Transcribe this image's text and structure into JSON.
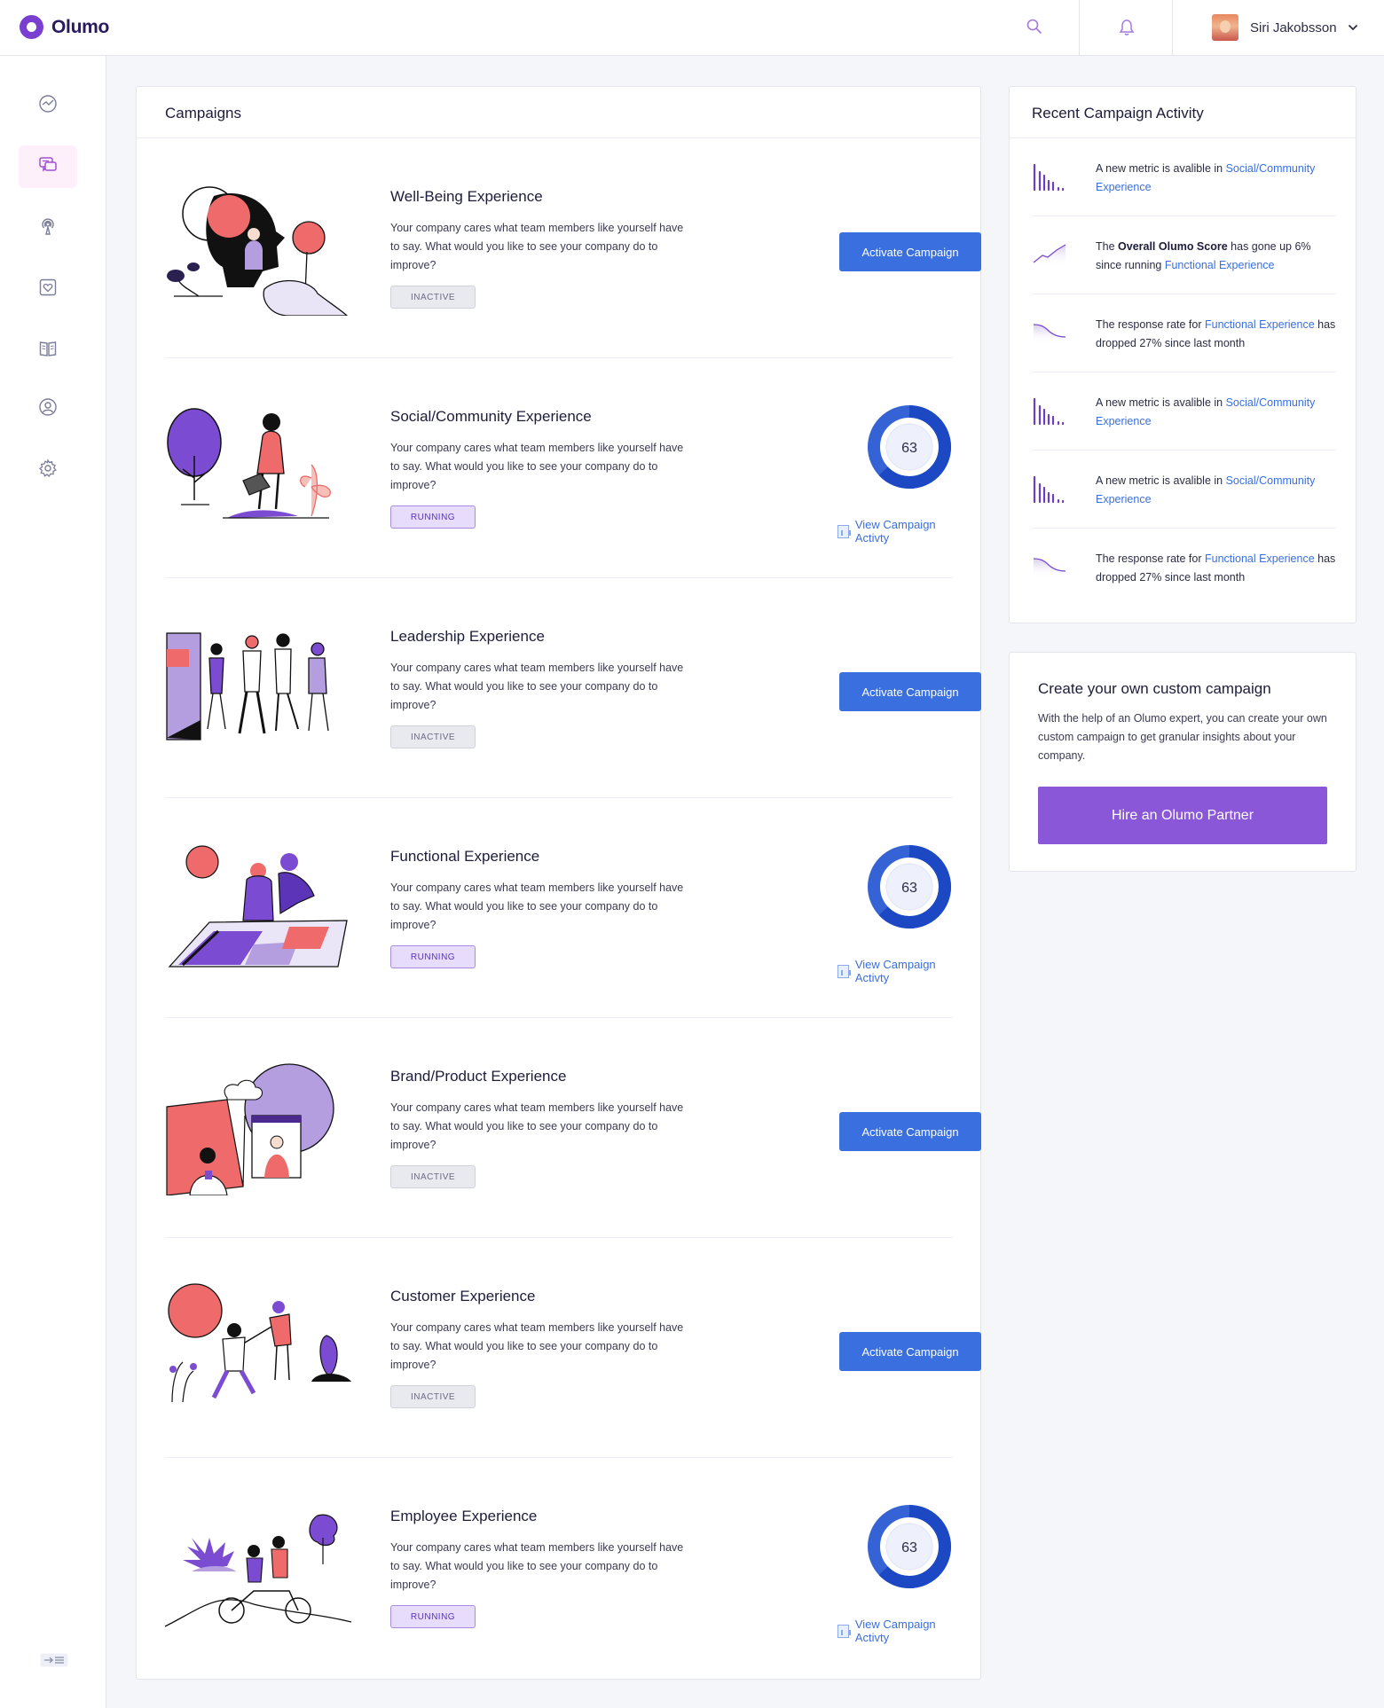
{
  "app": {
    "name": "Olumo"
  },
  "user": {
    "name": "Siri Jakobsson"
  },
  "campaigns_card": {
    "title": "Campaigns"
  },
  "campaigns": [
    {
      "title": "Well-Being Experience",
      "description": "Your company cares what team members like yourself have to say.  What would you like to see your company do to improve?",
      "status": "INACTIVE",
      "action": "Activate Campaign"
    },
    {
      "title": "Social/Community Experience",
      "description": "Your company cares what team members like yourself have to say.  What would you like to see your company do to improve?",
      "status": "RUNNING",
      "score": "63",
      "score_fraction": 0.63,
      "link": "View Campaign Activty"
    },
    {
      "title": "Leadership Experience",
      "description": "Your company cares what team members like yourself have to say.  What would you like to see your company do to improve?",
      "status": "INACTIVE",
      "action": "Activate Campaign"
    },
    {
      "title": "Functional Experience",
      "description": "Your company cares what team members like yourself have to say.  What would you like to see your company do to improve?",
      "status": "RUNNING",
      "score": "63",
      "score_fraction": 0.63,
      "link": "View Campaign Activty"
    },
    {
      "title": "Brand/Product Experience",
      "description": "Your company cares what team members like yourself have to say.  What would you like to see your company do to improve?",
      "status": "INACTIVE",
      "action": "Activate Campaign"
    },
    {
      "title": "Customer Experience",
      "description": "Your company cares what team members like yourself have to say.  What would you like to see your company do to improve?",
      "status": "INACTIVE",
      "action": "Activate Campaign"
    },
    {
      "title": "Employee Experience",
      "description": "Your company cares what team members like yourself have to say.  What would you like to see your company do to improve?",
      "status": "RUNNING",
      "score": "63",
      "score_fraction": 0.63,
      "link": "View Campaign Activty"
    }
  ],
  "activity": {
    "title": "Recent Campaign Activity",
    "items": [
      {
        "icon": "bar-chart-icon",
        "pre": "A new metric is avalible in ",
        "bold": "",
        "mid": "",
        "link": "Social/Community Experience",
        "post": ""
      },
      {
        "icon": "trend-up-icon",
        "pre": "The ",
        "bold": "Overall Olumo Score",
        "mid": " has gone up 6% since running ",
        "link": "Functional Experience",
        "post": ""
      },
      {
        "icon": "trend-down-icon",
        "pre": "The response rate for ",
        "bold": "",
        "mid": "",
        "link": "Functional Experience",
        "post": " has dropped 27% since last month"
      },
      {
        "icon": "bar-chart-icon",
        "pre": "A new metric is avalible in ",
        "bold": "",
        "mid": "",
        "link": "Social/Community Experience",
        "post": ""
      },
      {
        "icon": "bar-chart-icon",
        "pre": "A new metric is avalible in ",
        "bold": "",
        "mid": "",
        "link": "Social/Community Experience",
        "post": ""
      },
      {
        "icon": "trend-down-icon",
        "pre": "The response rate for ",
        "bold": "",
        "mid": "",
        "link": "Functional Experience",
        "post": " has dropped 27% since last month"
      }
    ]
  },
  "custom_campaign": {
    "title": "Create your own custom campaign",
    "description": "With the help of an Olumo expert, you can create your own custom campaign to get granular insights about your company.",
    "button": "Hire an Olumo Partner"
  },
  "sidebar": {
    "items": [
      {
        "icon": "dashboard-icon"
      },
      {
        "icon": "campaigns-icon",
        "active": true
      },
      {
        "icon": "broadcast-icon"
      },
      {
        "icon": "heart-icon"
      },
      {
        "icon": "book-icon"
      },
      {
        "icon": "profile-icon"
      },
      {
        "icon": "settings-icon"
      }
    ],
    "collapse_icon": "collapse-icon"
  },
  "colors": {
    "brand": "#7a3fd0",
    "primary_button": "#3a6fe0",
    "hire_button": "#8a57d9",
    "running_badge": "#e7dcfb",
    "inactive_badge": "#e9eaf0",
    "donut": "#1d48c4"
  }
}
